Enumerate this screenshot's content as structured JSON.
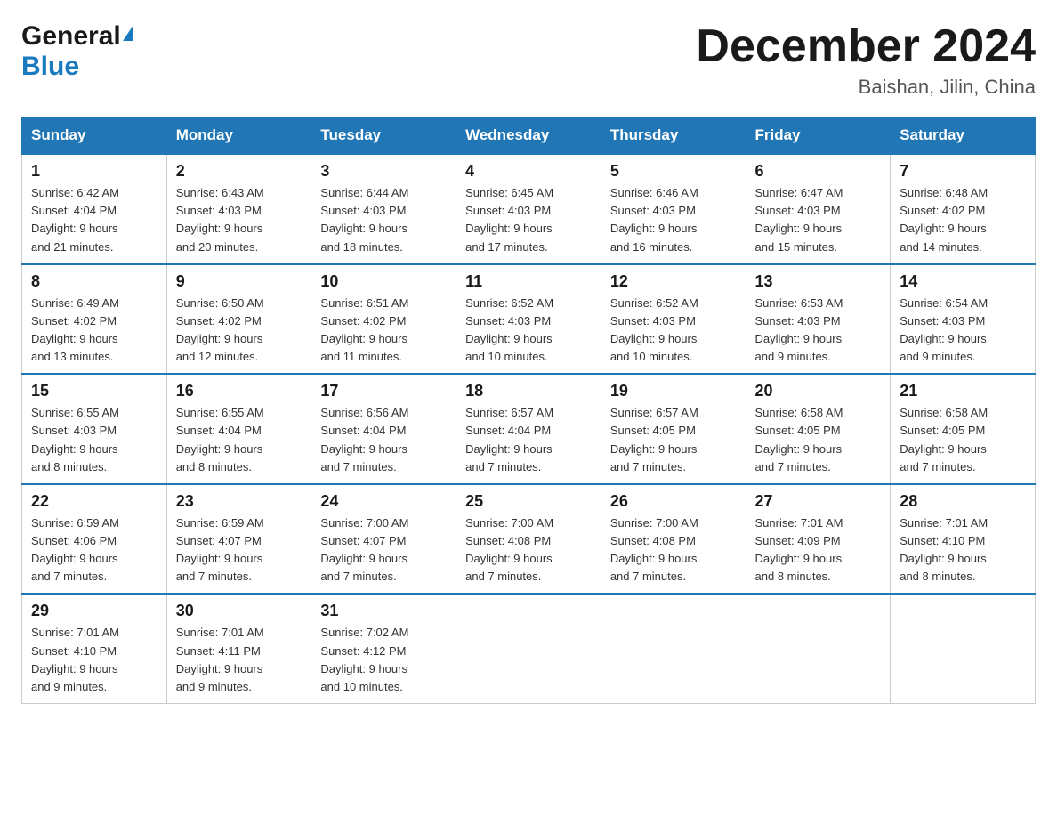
{
  "header": {
    "logo_general": "General",
    "logo_blue": "Blue",
    "title": "December 2024",
    "location": "Baishan, Jilin, China"
  },
  "days_of_week": [
    "Sunday",
    "Monday",
    "Tuesday",
    "Wednesday",
    "Thursday",
    "Friday",
    "Saturday"
  ],
  "weeks": [
    [
      {
        "day": "1",
        "sunrise": "6:42 AM",
        "sunset": "4:04 PM",
        "daylight": "9 hours and 21 minutes."
      },
      {
        "day": "2",
        "sunrise": "6:43 AM",
        "sunset": "4:03 PM",
        "daylight": "9 hours and 20 minutes."
      },
      {
        "day": "3",
        "sunrise": "6:44 AM",
        "sunset": "4:03 PM",
        "daylight": "9 hours and 18 minutes."
      },
      {
        "day": "4",
        "sunrise": "6:45 AM",
        "sunset": "4:03 PM",
        "daylight": "9 hours and 17 minutes."
      },
      {
        "day": "5",
        "sunrise": "6:46 AM",
        "sunset": "4:03 PM",
        "daylight": "9 hours and 16 minutes."
      },
      {
        "day": "6",
        "sunrise": "6:47 AM",
        "sunset": "4:03 PM",
        "daylight": "9 hours and 15 minutes."
      },
      {
        "day": "7",
        "sunrise": "6:48 AM",
        "sunset": "4:02 PM",
        "daylight": "9 hours and 14 minutes."
      }
    ],
    [
      {
        "day": "8",
        "sunrise": "6:49 AM",
        "sunset": "4:02 PM",
        "daylight": "9 hours and 13 minutes."
      },
      {
        "day": "9",
        "sunrise": "6:50 AM",
        "sunset": "4:02 PM",
        "daylight": "9 hours and 12 minutes."
      },
      {
        "day": "10",
        "sunrise": "6:51 AM",
        "sunset": "4:02 PM",
        "daylight": "9 hours and 11 minutes."
      },
      {
        "day": "11",
        "sunrise": "6:52 AM",
        "sunset": "4:03 PM",
        "daylight": "9 hours and 10 minutes."
      },
      {
        "day": "12",
        "sunrise": "6:52 AM",
        "sunset": "4:03 PM",
        "daylight": "9 hours and 10 minutes."
      },
      {
        "day": "13",
        "sunrise": "6:53 AM",
        "sunset": "4:03 PM",
        "daylight": "9 hours and 9 minutes."
      },
      {
        "day": "14",
        "sunrise": "6:54 AM",
        "sunset": "4:03 PM",
        "daylight": "9 hours and 9 minutes."
      }
    ],
    [
      {
        "day": "15",
        "sunrise": "6:55 AM",
        "sunset": "4:03 PM",
        "daylight": "9 hours and 8 minutes."
      },
      {
        "day": "16",
        "sunrise": "6:55 AM",
        "sunset": "4:04 PM",
        "daylight": "9 hours and 8 minutes."
      },
      {
        "day": "17",
        "sunrise": "6:56 AM",
        "sunset": "4:04 PM",
        "daylight": "9 hours and 7 minutes."
      },
      {
        "day": "18",
        "sunrise": "6:57 AM",
        "sunset": "4:04 PM",
        "daylight": "9 hours and 7 minutes."
      },
      {
        "day": "19",
        "sunrise": "6:57 AM",
        "sunset": "4:05 PM",
        "daylight": "9 hours and 7 minutes."
      },
      {
        "day": "20",
        "sunrise": "6:58 AM",
        "sunset": "4:05 PM",
        "daylight": "9 hours and 7 minutes."
      },
      {
        "day": "21",
        "sunrise": "6:58 AM",
        "sunset": "4:05 PM",
        "daylight": "9 hours and 7 minutes."
      }
    ],
    [
      {
        "day": "22",
        "sunrise": "6:59 AM",
        "sunset": "4:06 PM",
        "daylight": "9 hours and 7 minutes."
      },
      {
        "day": "23",
        "sunrise": "6:59 AM",
        "sunset": "4:07 PM",
        "daylight": "9 hours and 7 minutes."
      },
      {
        "day": "24",
        "sunrise": "7:00 AM",
        "sunset": "4:07 PM",
        "daylight": "9 hours and 7 minutes."
      },
      {
        "day": "25",
        "sunrise": "7:00 AM",
        "sunset": "4:08 PM",
        "daylight": "9 hours and 7 minutes."
      },
      {
        "day": "26",
        "sunrise": "7:00 AM",
        "sunset": "4:08 PM",
        "daylight": "9 hours and 7 minutes."
      },
      {
        "day": "27",
        "sunrise": "7:01 AM",
        "sunset": "4:09 PM",
        "daylight": "9 hours and 8 minutes."
      },
      {
        "day": "28",
        "sunrise": "7:01 AM",
        "sunset": "4:10 PM",
        "daylight": "9 hours and 8 minutes."
      }
    ],
    [
      {
        "day": "29",
        "sunrise": "7:01 AM",
        "sunset": "4:10 PM",
        "daylight": "9 hours and 9 minutes."
      },
      {
        "day": "30",
        "sunrise": "7:01 AM",
        "sunset": "4:11 PM",
        "daylight": "9 hours and 9 minutes."
      },
      {
        "day": "31",
        "sunrise": "7:02 AM",
        "sunset": "4:12 PM",
        "daylight": "9 hours and 10 minutes."
      },
      null,
      null,
      null,
      null
    ]
  ],
  "labels": {
    "sunrise": "Sunrise:",
    "sunset": "Sunset:",
    "daylight": "Daylight: 9 hours"
  }
}
